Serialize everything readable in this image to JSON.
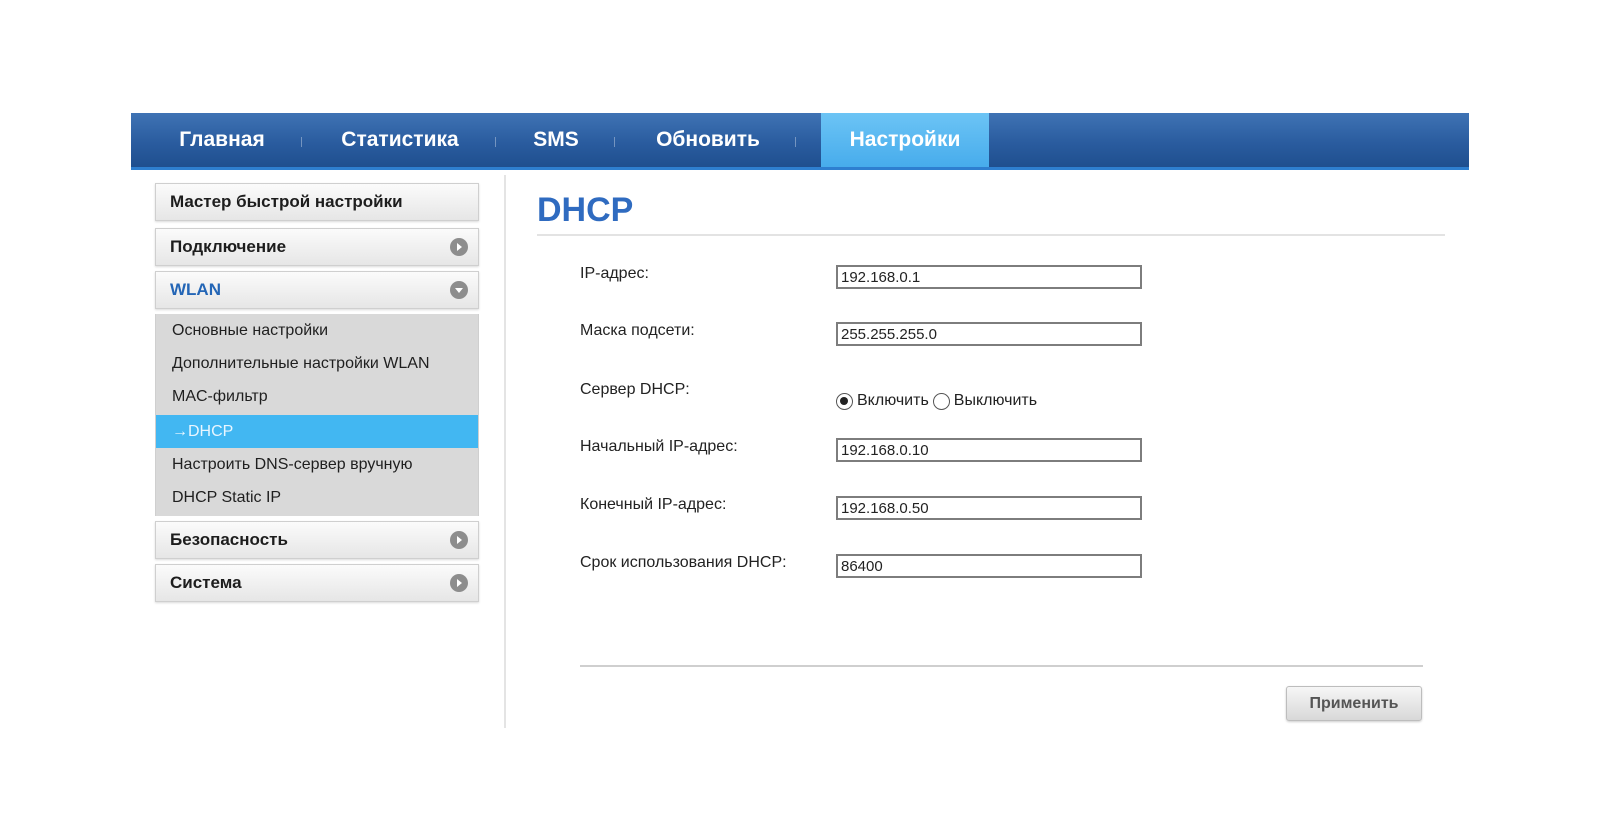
{
  "nav": {
    "tabs": [
      {
        "label": "Главная"
      },
      {
        "label": "Статистика"
      },
      {
        "label": "SMS"
      },
      {
        "label": "Обновить"
      },
      {
        "label": "Настройки",
        "active": true
      }
    ]
  },
  "sidebar": {
    "quick_setup": "Мастер быстрой настройки",
    "connection": "Подключение",
    "wlan": "WLAN",
    "wlan_items": [
      "Основные настройки",
      "Дополнительные настройки WLAN",
      "MAC-фильтр",
      "→DHCP",
      "Настроить DNS-сервер вручную",
      "DHCP Static IP"
    ],
    "security": "Безопасность",
    "system": "Система"
  },
  "content": {
    "title": "DHCP",
    "ip_label": "IP-адрес:",
    "ip_value": "192.168.0.1",
    "mask_label": "Маска подсети:",
    "mask_value": "255.255.255.0",
    "server_label": "Сервер DHCP:",
    "enable_label": "Включить",
    "disable_label": "Выключить",
    "start_label": "Начальный IP-адрес:",
    "start_value": "192.168.0.10",
    "end_label": "Конечный IP-адрес:",
    "end_value": "192.168.0.50",
    "lease_label": "Срок использования DHCP:",
    "lease_value": "86400",
    "apply_label": "Применить"
  },
  "colors": {
    "nav_blue": "#2a5c9f",
    "active_tab": "#47acec",
    "title_blue": "#2f6bc0",
    "selected_item": "#42b7f2"
  }
}
